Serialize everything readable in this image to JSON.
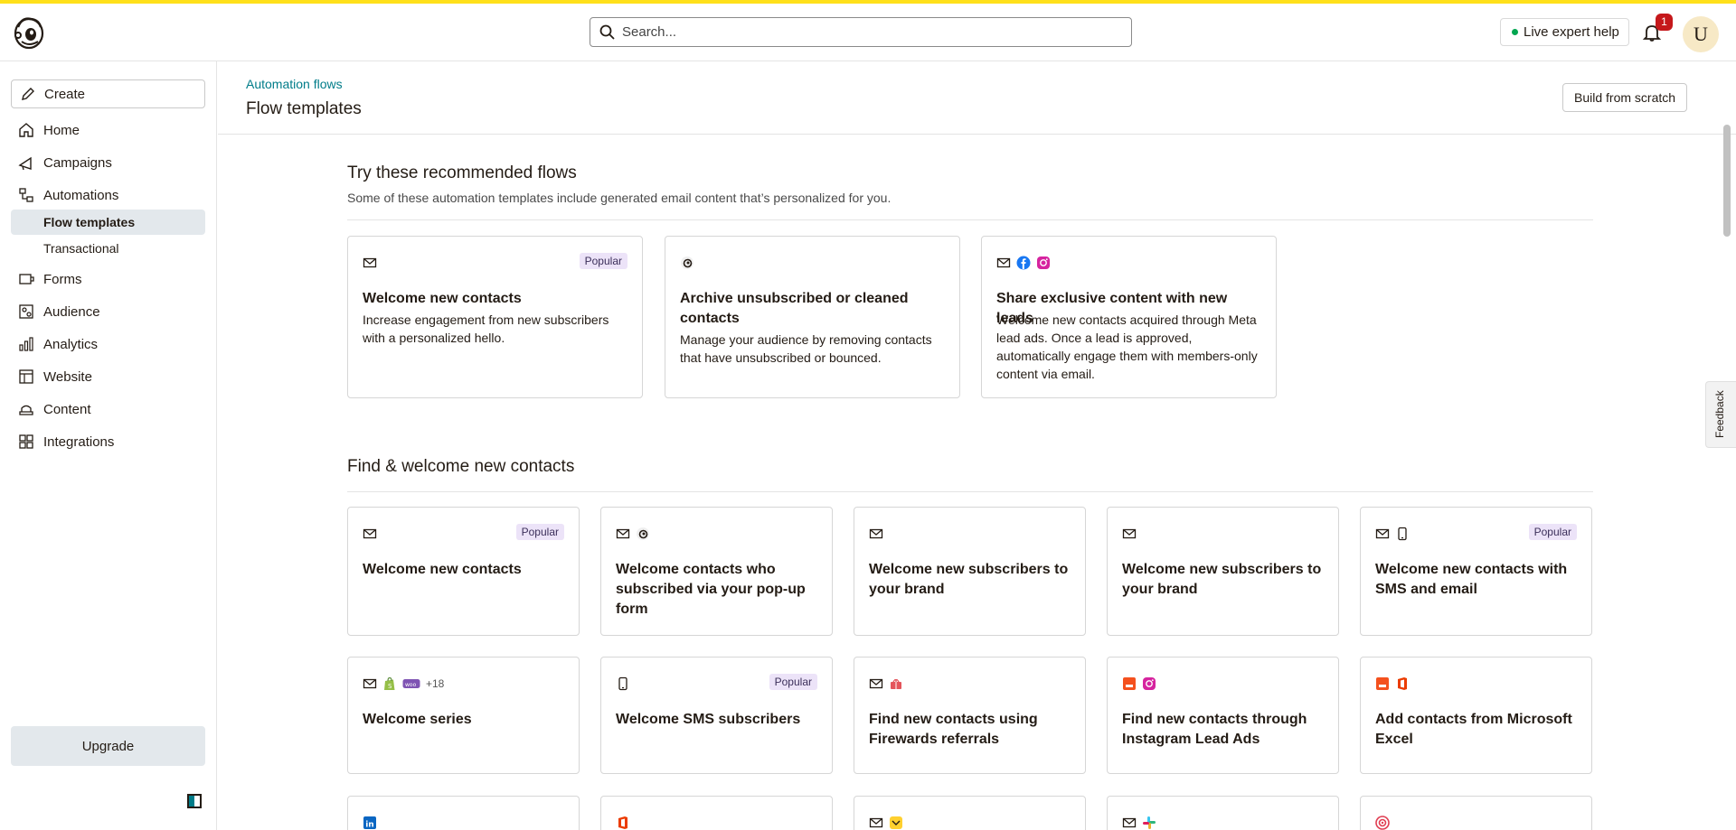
{
  "header": {
    "search_placeholder": "Search...",
    "live_help": "Live expert help",
    "notifications_count": "1",
    "avatar_initial": "U"
  },
  "sidebar": {
    "create": "Create",
    "items": [
      {
        "label": "Home",
        "icon": "home-icon"
      },
      {
        "label": "Campaigns",
        "icon": "megaphone-icon"
      },
      {
        "label": "Automations",
        "icon": "automations-icon"
      },
      {
        "label": "Forms",
        "icon": "forms-icon"
      },
      {
        "label": "Audience",
        "icon": "audience-icon"
      },
      {
        "label": "Analytics",
        "icon": "analytics-icon"
      },
      {
        "label": "Website",
        "icon": "website-icon"
      },
      {
        "label": "Content",
        "icon": "content-icon"
      },
      {
        "label": "Integrations",
        "icon": "integrations-icon"
      }
    ],
    "subitems": [
      "Flow templates",
      "Transactional"
    ],
    "upgrade": "Upgrade"
  },
  "page": {
    "breadcrumb": "Automation flows",
    "title": "Flow templates",
    "build_button": "Build from scratch",
    "feedback": "Feedback"
  },
  "recommended": {
    "title": "Try these recommended flows",
    "subtitle": "Some of these automation templates include generated email content that’s personalized for you.",
    "cards": [
      {
        "title": "Welcome new contacts",
        "description": "Increase engagement from new subscribers with a personalized hello.",
        "badge": "Popular",
        "icons": [
          "mail-icon"
        ]
      },
      {
        "title": "Archive unsubscribed or cleaned contacts",
        "description": "Manage your audience by removing contacts that have unsubscribed or bounced.",
        "badge": "",
        "icons": [
          "mailchimp-icon"
        ]
      },
      {
        "title": "Share exclusive content with new leads",
        "description": "Welcome new contacts acquired through Meta lead ads. Once a lead is approved, automatically engage them with members-only content via email.",
        "badge": "",
        "icons": [
          "mail-icon",
          "facebook-icon",
          "instagram-icon"
        ]
      }
    ]
  },
  "find": {
    "title": "Find & welcome new contacts",
    "cards": [
      {
        "title": "Welcome new contacts",
        "badge": "Popular",
        "icons": [
          "mail-icon"
        ]
      },
      {
        "title": "Welcome contacts who subscribed via your pop-up form",
        "badge": "",
        "icons": [
          "mail-icon",
          "mailchimp-icon"
        ]
      },
      {
        "title": "Welcome new subscribers to your brand",
        "badge": "",
        "icons": [
          "mail-icon"
        ]
      },
      {
        "title": "Welcome new subscribers to your brand",
        "badge": "",
        "icons": [
          "mail-icon"
        ]
      },
      {
        "title": "Welcome new contacts with SMS and email",
        "badge": "Popular",
        "icons": [
          "mail-icon",
          "phone-icon"
        ]
      },
      {
        "title": "Welcome series",
        "badge": "",
        "icons": [
          "mail-icon",
          "shopify-icon",
          "woo-icon"
        ],
        "extra": "+18"
      },
      {
        "title": "Welcome SMS subscribers",
        "badge": "Popular",
        "icons": [
          "phone-icon"
        ]
      },
      {
        "title": "Find new contacts using Firewards referrals",
        "badge": "",
        "icons": [
          "mail-icon",
          "firewards-icon"
        ]
      },
      {
        "title": "Find new contacts through Instagram Lead Ads",
        "badge": "",
        "icons": [
          "leadads-icon",
          "instagram-icon"
        ]
      },
      {
        "title": "Add contacts from Microsoft Excel",
        "badge": "",
        "icons": [
          "leadads-icon",
          "office-icon"
        ]
      }
    ],
    "partial_row_icons": [
      [
        "linkedin-icon"
      ],
      [
        "office-icon"
      ],
      [
        "mail-icon",
        "yellow-app-icon"
      ],
      [
        "mail-icon",
        "slack-icon"
      ],
      [
        "target-icon"
      ]
    ]
  },
  "colors": {
    "brand_yellow": "#ffe01b",
    "link_teal": "#007c89",
    "badge_red": "#c5181b",
    "popular_bg": "#ece3f8"
  }
}
